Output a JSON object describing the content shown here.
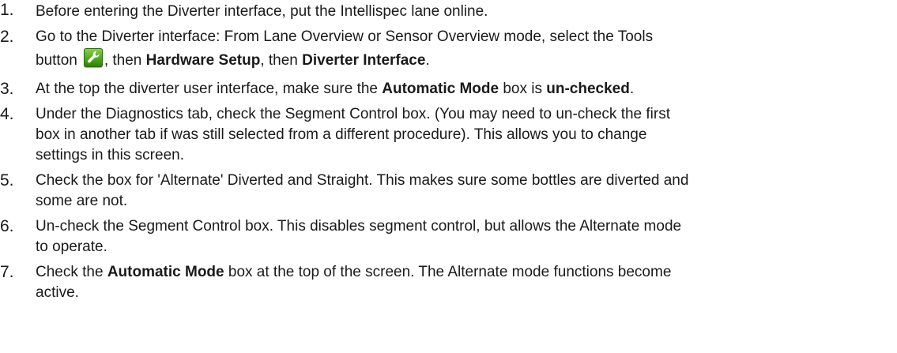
{
  "steps": [
    {
      "num": "1.",
      "text": "Before entering the Diverter interface, put the Intellispec lane online."
    },
    {
      "num": "2.",
      "text_a": "Go to the Diverter interface: From Lane Overview or Sensor Overview mode, select the Tools",
      "text_b": "button",
      "icon": "wrench-tools-icon",
      "text_c": ", then ",
      "bold_1": "Hardware Setup",
      "text_d": ", then ",
      "bold_2": "Diverter Interface",
      "text_e": "."
    },
    {
      "num": "3.",
      "text_a": "At the top the diverter user interface, make sure the ",
      "bold_1": "Automatic Mode",
      "text_b": " box is ",
      "bold_2": "un-checked",
      "text_c": "."
    },
    {
      "num": "4.",
      "line_1": "Under the Diagnostics tab, check the Segment Control box. (You may need to un-check the first",
      "line_2": "box in another tab if was still selected from a different procedure). This allows you to change",
      "line_3": "settings in this screen."
    },
    {
      "num": "5.",
      "line_1": "Check the box for 'Alternate' Diverted and Straight. This makes sure some bottles are diverted and",
      "line_2": "some are not."
    },
    {
      "num": "6.",
      "line_1": "Un-check the Segment Control box. This disables segment control, but allows the Alternate mode",
      "line_2": "to operate."
    },
    {
      "num": "7.",
      "text_a": "Check the ",
      "bold_1": "Automatic Mode",
      "text_b": " box at the top of the screen. The Alternate mode functions become",
      "line_2": "active."
    }
  ]
}
